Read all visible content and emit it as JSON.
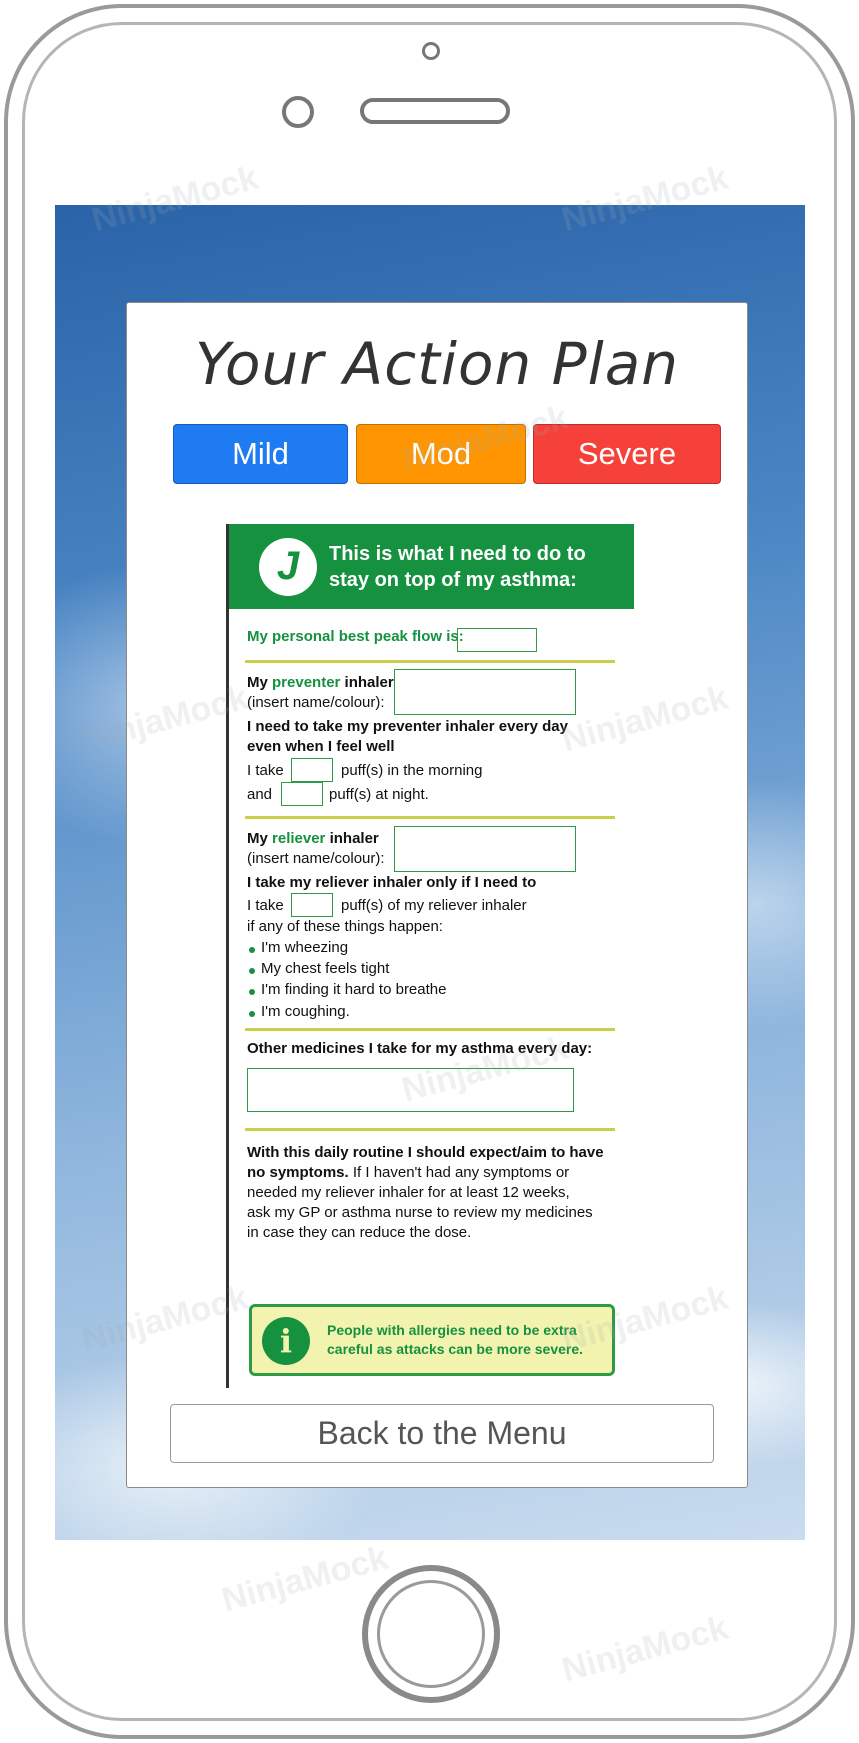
{
  "title": "Your Action Plan",
  "severity_buttons": [
    {
      "label": "Mild",
      "color": "#1e7bf2"
    },
    {
      "label": "Mod",
      "color": "#ff9500"
    },
    {
      "label": "Severe",
      "color": "#f5413a"
    }
  ],
  "document": {
    "header": "This is what I need to do to\nstay on top of my asthma:",
    "green": "#15913f",
    "peak_flow_label": "My personal best peak flow is:",
    "preventer": {
      "label_prefix": "My ",
      "label_highlight": "preventer",
      "label_suffix": " inhaler",
      "sublabel": "(insert name/colour):",
      "instruction_1": "I need to take my preventer inhaler every day",
      "instruction_2": "even when I feel well",
      "morning_prefix": "I take",
      "morning_suffix": "puff(s) in the morning",
      "night_prefix": "and",
      "night_suffix": "puff(s) at night."
    },
    "reliever": {
      "label_prefix": "My ",
      "label_highlight": "reliever",
      "label_suffix": " inhaler",
      "sublabel": "(insert name/colour):",
      "instruction": "I take my reliever inhaler only if I need to",
      "take_prefix": "I take",
      "take_suffix": "puff(s) of my reliever inhaler",
      "condition": "if any of these things happen:",
      "symptoms": [
        "I'm wheezing",
        "My chest feels tight",
        "I'm finding it hard to breathe",
        "I'm coughing."
      ]
    },
    "other_medicines_label": "Other medicines I take for my asthma every day:",
    "routine_bold_1": "With this daily routine I should expect/aim to have",
    "routine_bold_2": "no symptoms.",
    "routine_rest_2": " If I haven't had any symptoms or",
    "routine_line_3": "needed my reliever inhaler for at least 12 weeks,",
    "routine_line_4": "ask my GP or asthma nurse to review my medicines",
    "routine_line_5": "in case they can reduce the dose.",
    "info": "People with allergies need to be extra careful as attacks can be more severe.",
    "info_icon": "i",
    "logo_glyph": "J"
  },
  "back_button": "Back to the Menu",
  "watermark": "NinjaMock"
}
